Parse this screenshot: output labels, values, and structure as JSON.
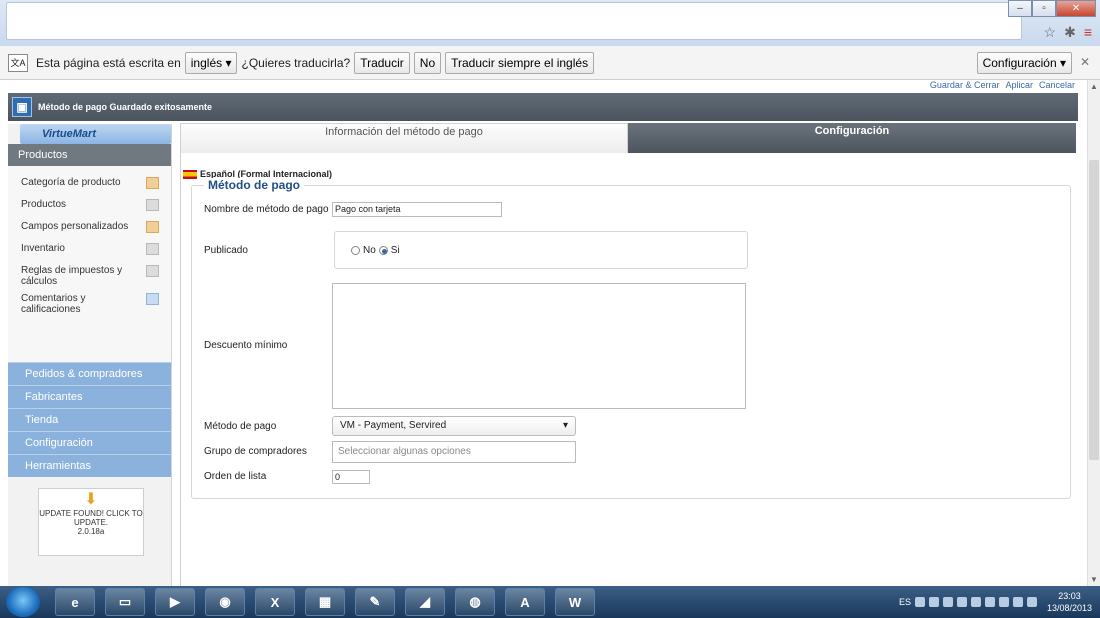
{
  "browser": {
    "window_buttons": {
      "minimize": "–",
      "maximize": "▫",
      "close": "✕"
    },
    "icons": [
      "star-icon",
      "extension-icon",
      "menu-icon"
    ]
  },
  "translate_bar": {
    "prefix": "Esta página está escrita en",
    "language": "inglés ▾",
    "question": "¿Quieres traducirla?",
    "translate_btn": "Traducir",
    "no_btn": "No",
    "always_btn": "Traducir siempre el inglés",
    "config_btn": "Configuración ▾",
    "close": "✕"
  },
  "toolbar": {
    "save_close": "Guardar & Cerrar",
    "apply": "Aplicar",
    "cancel": "Cancelar"
  },
  "message": "Método de pago Guardado exitosamente",
  "sidebar": {
    "logo": "VirtueMart",
    "section": "Productos",
    "items": [
      {
        "label": "Categoría de producto",
        "icon": "category-icon"
      },
      {
        "label": "Productos",
        "icon": "products-icon"
      },
      {
        "label": "Campos personalizados",
        "icon": "custom-fields-icon"
      },
      {
        "label": "Inventario",
        "icon": "inventory-icon"
      },
      {
        "label": "Reglas de impuestos y cálculos",
        "icon": "calculator-icon"
      },
      {
        "label": "Comentarios y calificaciones",
        "icon": "comments-icon"
      }
    ],
    "nav": [
      "Pedidos & compradores",
      "Fabricantes",
      "Tienda",
      "Configuración",
      "Herramientas"
    ],
    "update": {
      "text": "UPDATE FOUND! CLICK TO UPDATE.",
      "version": "2.0.18a"
    }
  },
  "tabs": [
    "Información del método de pago",
    "Configuración"
  ],
  "form": {
    "language": "Español (Formal Internacional)",
    "legend": "Método de pago",
    "name_label": "Nombre de método de pago",
    "name_value": "Pago con tarjeta",
    "published_label": "Publicado",
    "published_no": "No",
    "published_yes": "Si",
    "published_selected": "Si",
    "discount_label": "Descuento mínimo",
    "method_label": "Método de pago",
    "method_value": "VM - Payment, Servired",
    "group_label": "Grupo de compradores",
    "group_placeholder": "Seleccionar algunas opciones",
    "order_label": "Orden de lista",
    "order_value": "0"
  },
  "taskbar": {
    "apps": [
      "ie-icon",
      "explorer-icon",
      "media-icon",
      "chrome-icon",
      "excel-icon",
      "network-icon",
      "gimp-icon",
      "notes-icon",
      "firefox-icon",
      "acrobat-icon",
      "word-icon"
    ],
    "lang": "ES",
    "time": "23:03",
    "date": "13/08/2013"
  }
}
